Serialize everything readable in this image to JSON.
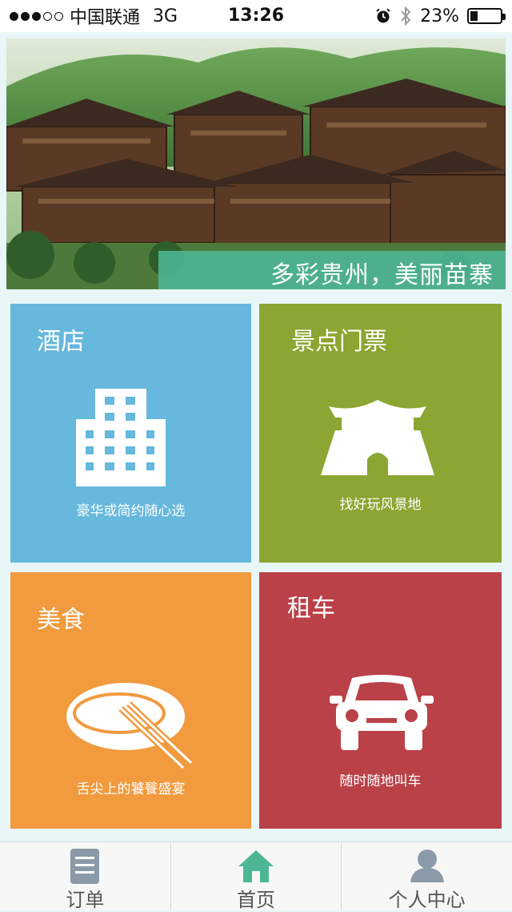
{
  "status_bar": {
    "carrier": "中国联通",
    "network": "3G",
    "time": "13:26",
    "battery": "23%",
    "battery_level": 0.23,
    "signal_strength": 3,
    "icons": [
      "alarm-icon",
      "bluetooth-icon",
      "battery-icon"
    ]
  },
  "banner": {
    "caption": "多彩贵州，美丽苗寨"
  },
  "tiles": [
    {
      "title": "酒店",
      "subtitle": "豪华或简约随心选",
      "icon": "building-icon",
      "color": "#66b8dc"
    },
    {
      "title": "景点门票",
      "subtitle": "找好玩风景地",
      "icon": "gate-icon",
      "color": "#8ba632"
    },
    {
      "title": "美食",
      "subtitle": "舌尖上的饕餮盛宴",
      "icon": "plate-chopsticks-icon",
      "color": "#f19a3e"
    },
    {
      "title": "租车",
      "subtitle": "随时随地叫车",
      "icon": "car-icon",
      "color": "#b94147"
    }
  ],
  "tab_bar": {
    "items": [
      {
        "label": "订单",
        "icon": "order-list-icon",
        "color": "#8a9aa8"
      },
      {
        "label": "首页",
        "icon": "home-icon",
        "color": "#4db795"
      },
      {
        "label": "个人中心",
        "icon": "user-icon",
        "color": "#8a9aa8"
      }
    ]
  }
}
